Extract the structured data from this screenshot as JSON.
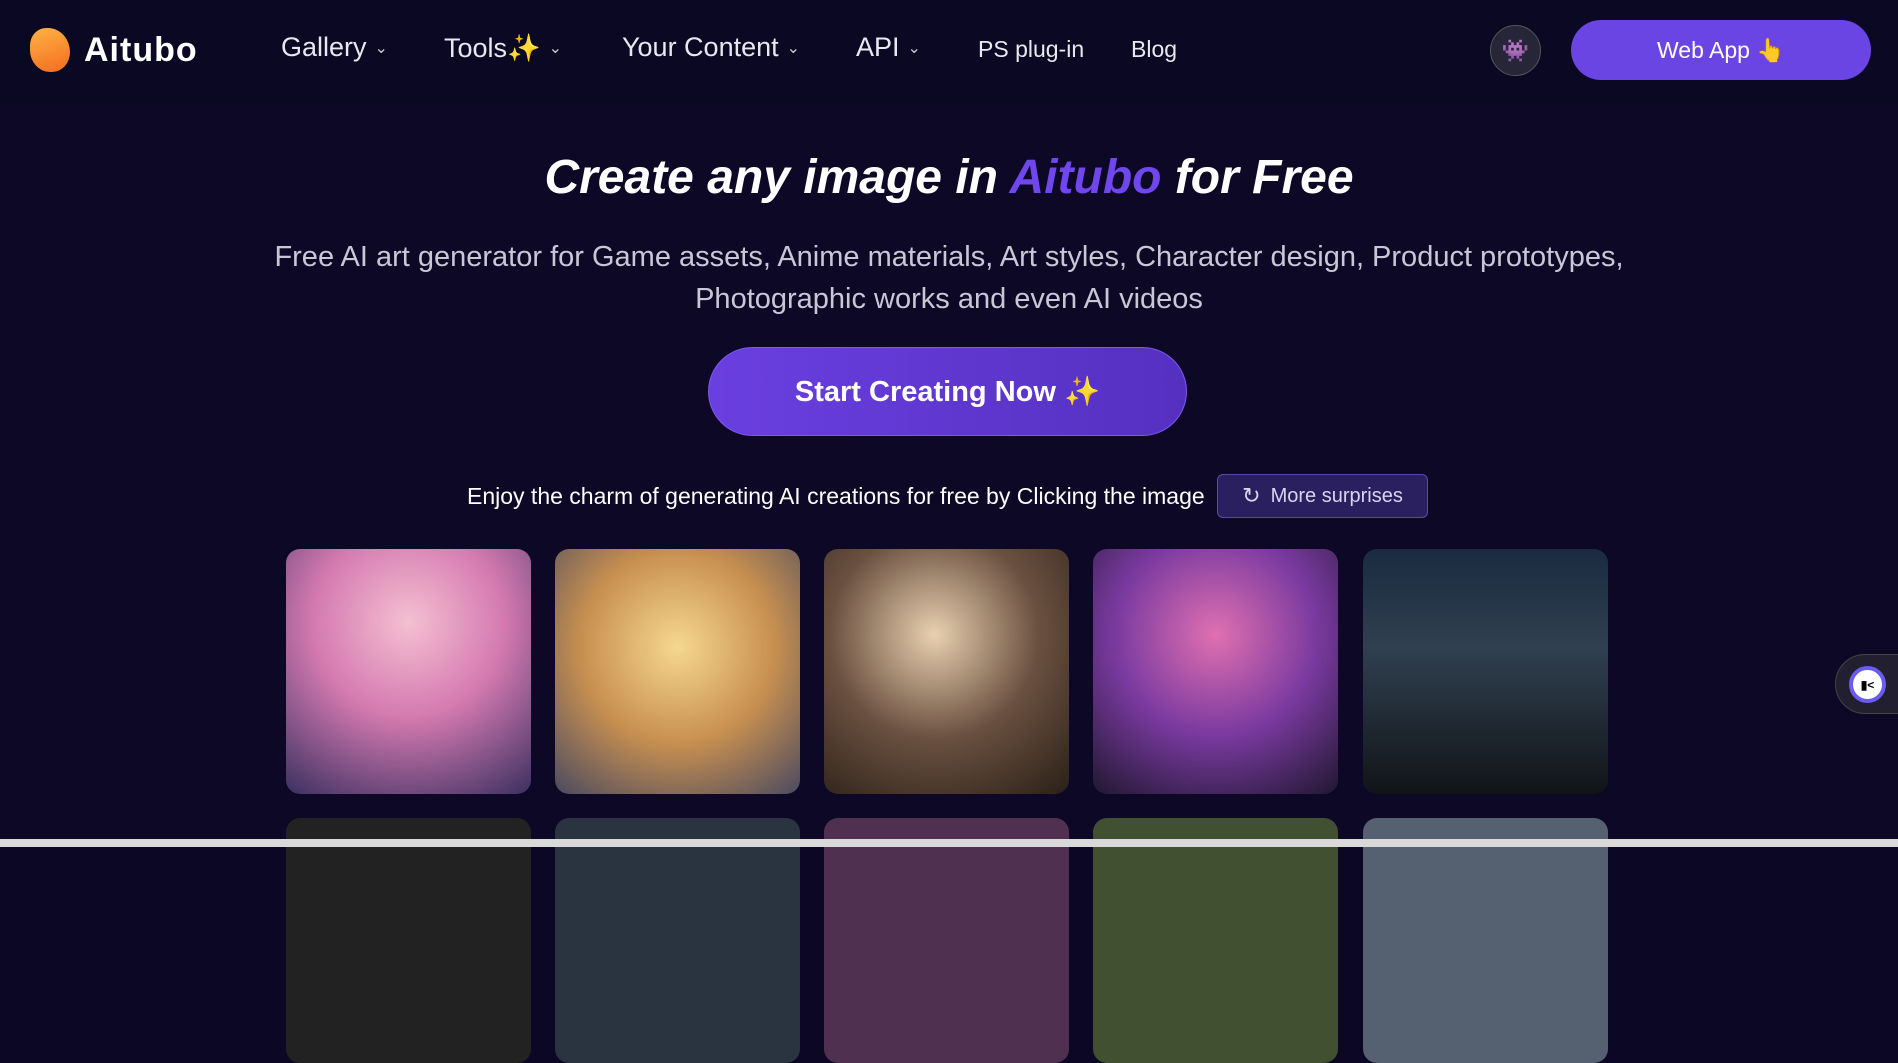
{
  "header": {
    "logo": "Aitubo",
    "nav": [
      {
        "label": "Gallery"
      },
      {
        "label": "Tools✨"
      },
      {
        "label": "Your Content"
      },
      {
        "label": "API"
      },
      {
        "label": "PS plug-in"
      },
      {
        "label": "Blog"
      }
    ],
    "web_app": "Web App 👆"
  },
  "hero": {
    "title_pre": "Create any image in ",
    "title_accent": "Aitubo",
    "title_post": " for Free",
    "subtitle_line1": "Free AI art generator for Game assets, Anime materials, Art styles, Character design, Product prototypes,",
    "subtitle_line2": "Photographic works and even AI videos",
    "cta": "Start Creating Now ✨",
    "enjoy": "Enjoy the charm of generating AI creations for free by Clicking the image",
    "more": "More surprises"
  },
  "colors": {
    "accent": "#6b45e3",
    "bg": "#0c0826"
  }
}
